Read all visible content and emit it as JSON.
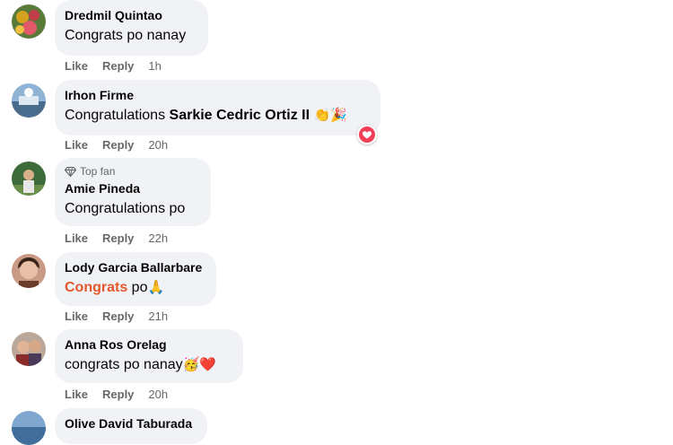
{
  "colors": {
    "bubble": "#f0f2f5",
    "meta": "#65676b",
    "name": "#050505",
    "highlight": "#e4572e",
    "love": "#f33e58"
  },
  "comments": [
    {
      "author": "Dredmil Quintao",
      "text": "Congrats po nanay",
      "like": "Like",
      "reply": "Reply",
      "time": "1h",
      "avatar_icon": "flowers-avatar-icon"
    },
    {
      "author": "Irhon Firme",
      "text_prefix": "Congratulations ",
      "mention": "Sarkie Cedric Ortiz II",
      "emojis": "👏🎉",
      "like": "Like",
      "reply": "Reply",
      "time": "20h",
      "reaction_icon": "love-reaction-icon"
    },
    {
      "badge": "Top fan",
      "badge_icon": "diamond-icon",
      "author": "Amie Pineda",
      "text": "Congratulations po",
      "like": "Like",
      "reply": "Reply",
      "time": "22h"
    },
    {
      "author": "Lody Garcia Ballarbare",
      "highlight": "Congrats",
      "text_suffix": " po",
      "emojis": "🙏",
      "like": "Like",
      "reply": "Reply",
      "time": "21h"
    },
    {
      "author": "Anna Ros Orelag",
      "text": "congrats po nanay",
      "emojis": "🥳❤️",
      "like": "Like",
      "reply": "Reply",
      "time": "20h"
    },
    {
      "author": "Olive David Taburada"
    }
  ]
}
